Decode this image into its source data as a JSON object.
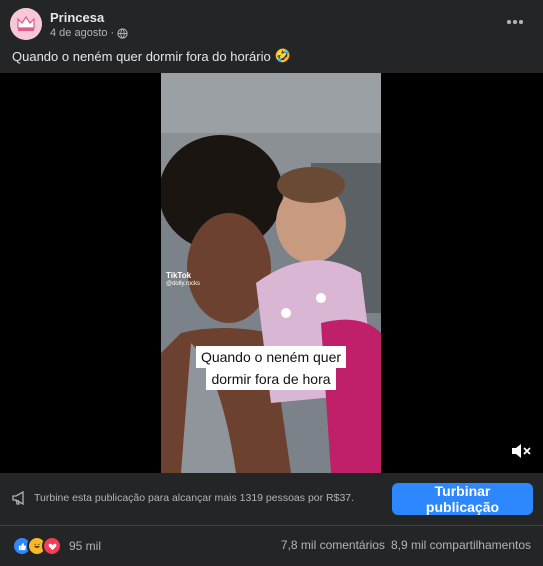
{
  "post": {
    "author": "Princesa",
    "date": "4 de agosto",
    "caption": "Quando o neném quer dormir fora do horário",
    "caption_emoji": "🤣"
  },
  "video": {
    "watermark_brand": "TikTok",
    "watermark_user": "@dolly.rocks",
    "overlay_text_line1": "Quando o neném quer",
    "overlay_text_line2": "dormir fora de hora"
  },
  "boost": {
    "text": "Turbine esta publicação para alcançar mais 1319 pessoas por R$37.",
    "button_label": "Turbinar publicação"
  },
  "stats": {
    "reactions_count": "95 mil",
    "reaction_icons": [
      "like-icon",
      "haha-icon",
      "love-icon"
    ],
    "comments": "7,8 mil comentários",
    "shares": "8,9 mil compartilhamentos"
  },
  "colors": {
    "background": "#242526",
    "accent": "#2d88ff",
    "text_primary": "#e4e6eb",
    "text_secondary": "#b0b3b8"
  }
}
